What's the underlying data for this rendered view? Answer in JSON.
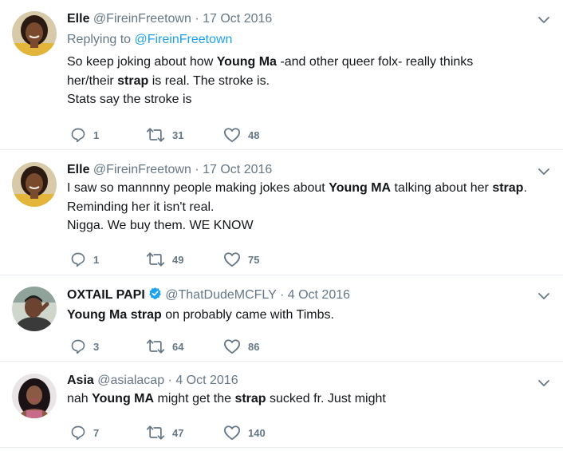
{
  "tweets": [
    {
      "name": "Elle",
      "handle": "@FireinFreetown",
      "date": "17 Oct 2016",
      "replying_label": "Replying to",
      "replying_handle": "@FireinFreetown",
      "lines": [
        [
          {
            "t": "So keep joking about how "
          },
          {
            "t": "Young Ma",
            "b": true
          },
          {
            "t": " -and other queer folx- really thinks"
          }
        ],
        [
          {
            "t": "her/their "
          },
          {
            "t": "strap",
            "b": true
          },
          {
            "t": " is real. The stroke is."
          }
        ],
        [
          {
            "t": "Stats say the stroke is"
          }
        ]
      ],
      "replies": "1",
      "retweets": "31",
      "likes": "48",
      "avatar": "avatar-elle"
    },
    {
      "name": "Elle",
      "handle": "@FireinFreetown",
      "date": "17 Oct 2016",
      "lines": [
        [
          {
            "t": "I saw so mannnny people making jokes about "
          },
          {
            "t": "Young MA",
            "b": true
          },
          {
            "t": " talking about her "
          },
          {
            "t": "strap",
            "b": true
          },
          {
            "t": "."
          }
        ],
        [
          {
            "t": "Reminding her it isn't real."
          }
        ],
        [
          {
            "t": "Nigga. We buy them. WE KNOW"
          }
        ]
      ],
      "replies": "1",
      "retweets": "49",
      "likes": "75",
      "avatar": "avatar-elle"
    },
    {
      "name": "OXTAIL PAPI",
      "verified": true,
      "handle": "@ThatDudeMCFLY",
      "date": "4 Oct 2016",
      "lines": [
        [
          {
            "t": "Young Ma",
            "b": true
          },
          {
            "t": " "
          },
          {
            "t": "strap",
            "b": true
          },
          {
            "t": " on probably came with Timbs."
          }
        ]
      ],
      "replies": "3",
      "retweets": "64",
      "likes": "86",
      "avatar": "avatar-oxtail"
    },
    {
      "name": "Asia",
      "handle": "@asialacap",
      "date": "4 Oct 2016",
      "lines": [
        [
          {
            "t": "nah "
          },
          {
            "t": "Young MA",
            "b": true
          },
          {
            "t": " might get the "
          },
          {
            "t": "strap",
            "b": true
          },
          {
            "t": " sucked fr. Just might"
          }
        ]
      ],
      "replies": "7",
      "retweets": "47",
      "likes": "140",
      "avatar": "avatar-asia"
    }
  ],
  "separator": "·",
  "colors": {
    "text": "#14171a",
    "muted": "#657786",
    "link": "#1da1f2",
    "border": "#e6ecf0",
    "verified": "#1da1f2"
  }
}
